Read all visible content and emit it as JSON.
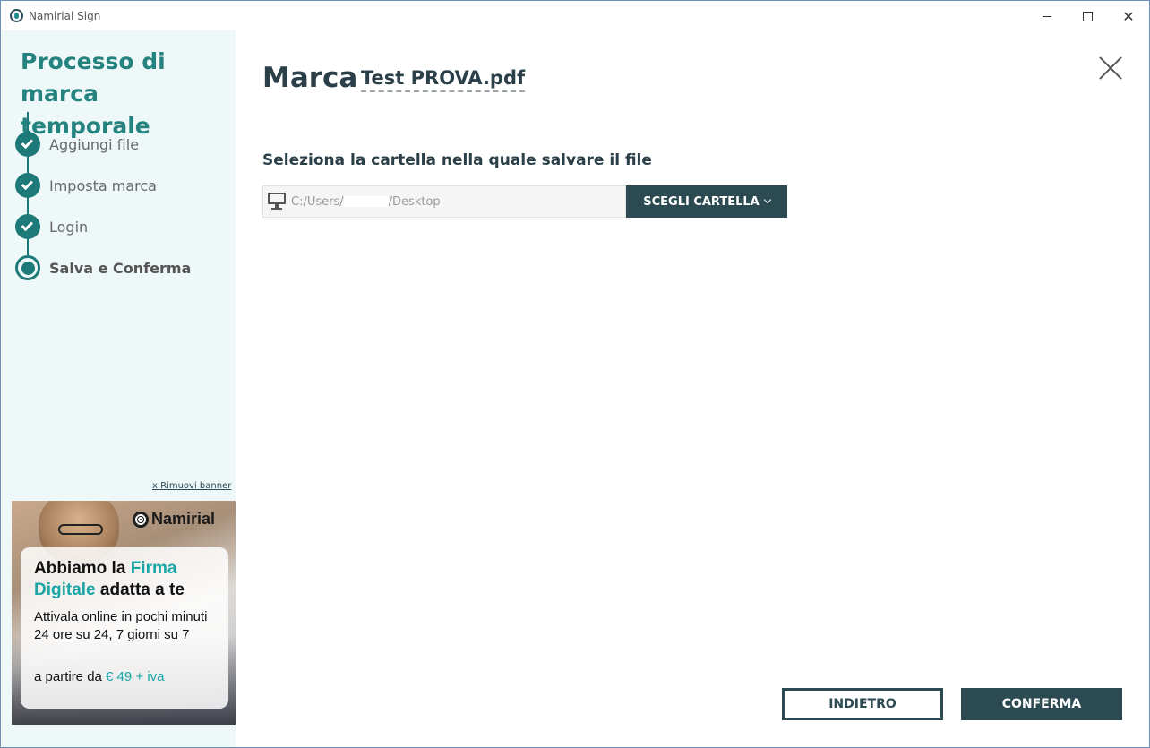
{
  "window": {
    "title": "Namirial Sign",
    "icon": "namirial-app-icon",
    "controls": {
      "minimize": "minimize-icon",
      "maximize": "maximize-icon",
      "close": "✕"
    }
  },
  "sidebar": {
    "process_title": "Processo di marca temporale",
    "steps": [
      {
        "label": "Aggiungi file",
        "state": "done"
      },
      {
        "label": "Imposta marca",
        "state": "done"
      },
      {
        "label": "Login",
        "state": "done"
      },
      {
        "label": "Salva e Conferma",
        "state": "current"
      }
    ],
    "remove_banner": "x Rimuovi banner",
    "banner": {
      "brand": "Namirial",
      "headline_1": "Abbiamo la ",
      "headline_accent_1": "Firma",
      "headline_accent_2": "Digitale",
      "headline_2": " adatta a te",
      "body": "Attivala online in pochi minuti 24 ore su 24, 7 giorni su 7",
      "price_prefix": "a partire da ",
      "price_accent": "€ 49 + iva"
    }
  },
  "main": {
    "title": "Marca",
    "filename": "Test PROVA.pdf",
    "section_label": "Seleziona la cartella nella quale salvare il file",
    "path_value": "C:/Users/",
    "path_value_end": "/Desktop",
    "choose_button": "SCEGLI CARTELLA",
    "back_button": "INDIETRO",
    "confirm_button": "CONFERMA"
  },
  "colors": {
    "accent_teal": "#1d7a78",
    "title_teal": "#24837f",
    "dark_button": "#2b4a52",
    "sidebar_bg": "#eef8f8",
    "banner_accent": "#1aa6a6"
  }
}
